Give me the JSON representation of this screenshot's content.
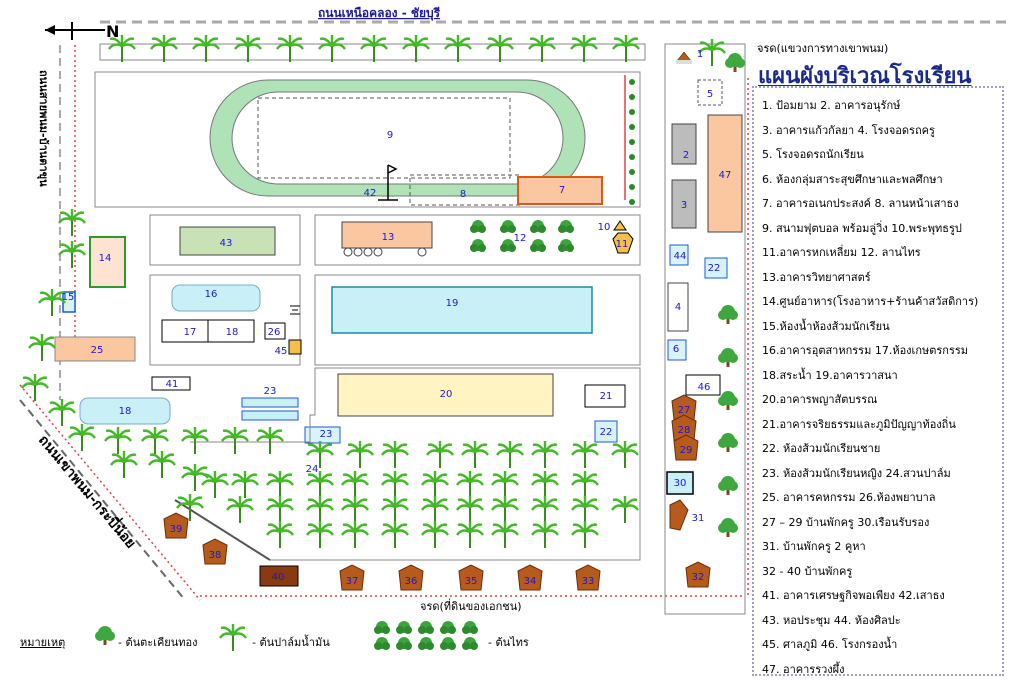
{
  "roads": {
    "north": "ถนนเหนือคลอง - ชัยบุรี",
    "west": "ถนนสายพนม-บ้านตาขุน",
    "southwest": "ถนนเขาพนม-กระบี่น้อย",
    "top_right": "จรด(แขวงการทางเขาพนม)",
    "south": "จรด(ที่ดินของเอกชน)"
  },
  "north_mark": "N",
  "title": "แผนผังบริเวณโรงเรียน",
  "legend": [
    "1. ป้อมยาม          2. อาคารอนุรักษ์",
    "3. อาคารแก้วกัลยา       4. โรงจอดรถครู",
    "5. โรงจอดรถนักเรียน",
    "6. ห้องกลุ่มสาระสุขศึกษาและพลศึกษา",
    "7. อาคารอเนกประสงค์  8. ลานหน้าเสาธง",
    "9. สนามฟุตบอล พร้อมลู่วิ่ง  10.พระพุทธรูป",
    "11.อาคารหกเหลี่ยม  12. ลานไทร",
    "13.อาคารวิทยาศาสตร์",
    "14.ศูนย์อาหาร(โรงอาหาร+ร้านค้าสวัสดิการ)",
    "15.ห้องน้ำห้องส้วมนักเรียน",
    "16.อาคารอุตสาหกรรม  17.ห้องเกษตรกรรม",
    "18.สระน้ำ     19.อาคารวาสนา",
    "20.อาคารพญาสัตบรรณ",
    "21.อาคารจริยธรรมและภูมิปัญญาท้องถิ่น",
    "22. ห้องส้วมนักเรียนชาย",
    "23. ห้องส้วมนักเรียนหญิง  24.สวนปาล์ม",
    "25. อาคารคหกรรม     26.ห้องพยาบาล",
    "27 – 29 บ้านพักครู  30.เรือนรับรอง",
    "31. บ้านพักครู 2 คูหา",
    "32 - 40 บ้านพักครู",
    "41. อาคารเศรษฐกิจพอเพียง  42.เสาธง",
    "43. หอประชุม   44. ห้องศิลปะ",
    "45. ศาลภูมิ     46. โรงกรองน้ำ",
    "47. อาคารรวงผึ้ง"
  ],
  "key": {
    "heading": "หมายเหตุ",
    "tree1": "- ต้นตะเคียนทอง",
    "tree2": "- ต้นปาล์มน้ำมัน",
    "tree3": "- ต้นไทร"
  },
  "numbers": [
    "1",
    "2",
    "3",
    "4",
    "5",
    "6",
    "9",
    "8",
    "7",
    "42",
    "10",
    "11",
    "12",
    "13",
    "14",
    "15",
    "16",
    "17",
    "18",
    "18",
    "19",
    "20",
    "21",
    "22",
    "22",
    "23",
    "23",
    "24",
    "25",
    "26",
    "27",
    "28",
    "29",
    "30",
    "31",
    "32",
    "33",
    "34",
    "35",
    "36",
    "37",
    "38",
    "39",
    "40",
    "41",
    "43",
    "44",
    "45",
    "46",
    "47"
  ],
  "colors": {
    "track": "#b0e2b8",
    "building_orange": "#fbc7a0",
    "building_green": "#c8e2b6",
    "pool": "#c8f0f6",
    "building_yellow": "#fff4c2",
    "gray": "#bcbcbc",
    "label_blue": "#1a1acc",
    "road_line": "#dd4444",
    "tree_green": "#2a9a2a"
  }
}
